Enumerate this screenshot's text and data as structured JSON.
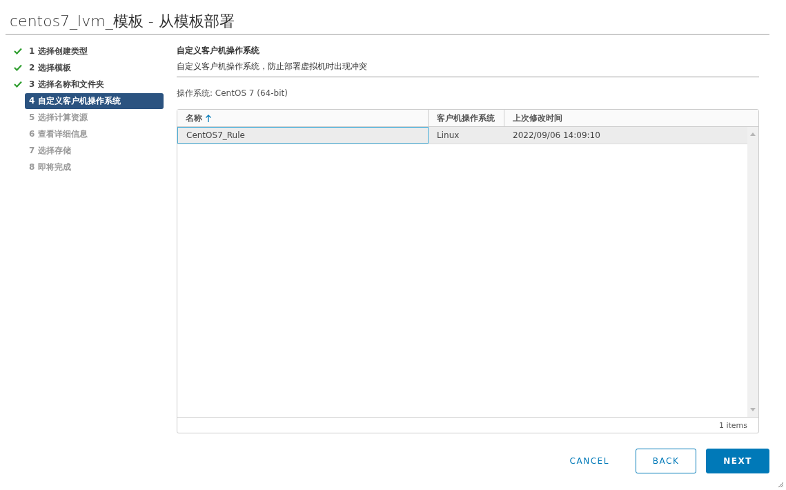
{
  "window": {
    "title": "centos7_lvm_模板 - 从模板部署"
  },
  "steps": [
    {
      "label": "1 选择创建类型",
      "completed": true,
      "selected": false,
      "disabled": false
    },
    {
      "label": "2 选择模板",
      "completed": true,
      "selected": false,
      "disabled": false
    },
    {
      "label": "3 选择名称和文件夹",
      "completed": true,
      "selected": false,
      "disabled": false
    },
    {
      "label": "4 自定义客户机操作系统",
      "completed": false,
      "selected": true,
      "disabled": false
    },
    {
      "label": "5 选择计算资源",
      "completed": false,
      "selected": false,
      "disabled": true
    },
    {
      "label": "6 查看详细信息",
      "completed": false,
      "selected": false,
      "disabled": true
    },
    {
      "label": "7 选择存储",
      "completed": false,
      "selected": false,
      "disabled": true
    },
    {
      "label": "8 即将完成",
      "completed": false,
      "selected": false,
      "disabled": true
    }
  ],
  "section": {
    "title": "自定义客户机操作系统",
    "description": "自定义客户机操作系统，防止部署虚拟机时出现冲突"
  },
  "os_label": "操作系统: CentOS 7 (64-bit)",
  "table": {
    "columns": [
      {
        "label": "名称",
        "sorted": true
      },
      {
        "label": "客户机操作系统",
        "sorted": false
      },
      {
        "label": "上次修改时间",
        "sorted": false
      }
    ],
    "rows": [
      {
        "cells": [
          "CentOS7_Rule",
          "Linux",
          "2022/09/06 14:09:10"
        ],
        "selected": true
      }
    ],
    "footer": "1 items"
  },
  "buttons": [
    {
      "label": "CANCEL",
      "kind": "link"
    },
    {
      "label": "BACK",
      "kind": "outline"
    },
    {
      "label": "NEXT",
      "kind": "primary"
    }
  ]
}
